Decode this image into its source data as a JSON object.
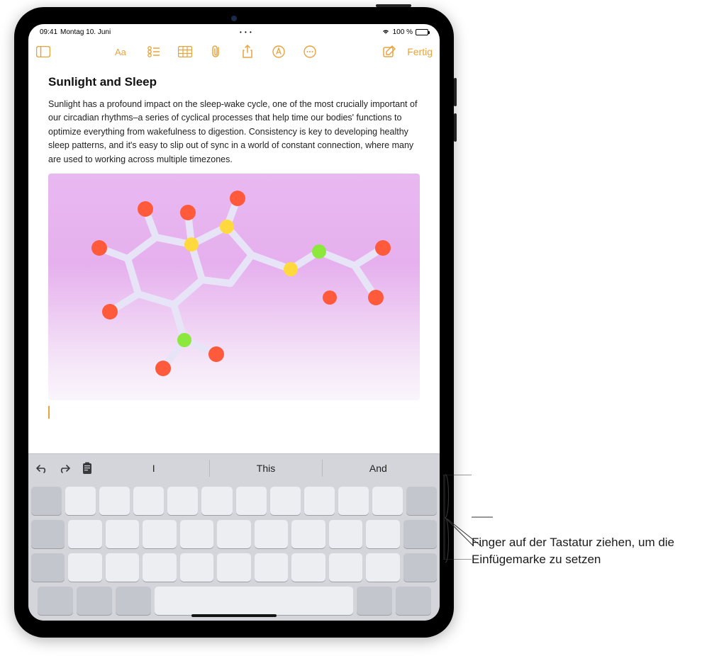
{
  "status": {
    "time": "09:41",
    "date": "Montag 10. Juni",
    "battery_pct": "100 %"
  },
  "toolbar": {
    "done_label": "Fertig"
  },
  "note": {
    "title": "Sunlight and Sleep",
    "body": "Sunlight has a profound impact on the sleep-wake cycle, one of the most crucially important of our circadian rhythms–a series of cyclical processes that help time our bodies' functions to optimize everything from wakefulness to digestion. Consistency is key to developing healthy sleep patterns, and it's easy to slip out of sync in a world of constant connection, where many are used to working across multiple timezones."
  },
  "predictions": [
    "I",
    "This",
    "And"
  ],
  "callout": {
    "text": "Finger auf der Tastatur ziehen, um die Einfügemarke zu setzen"
  },
  "colors": {
    "accent": "#e8a33d"
  }
}
